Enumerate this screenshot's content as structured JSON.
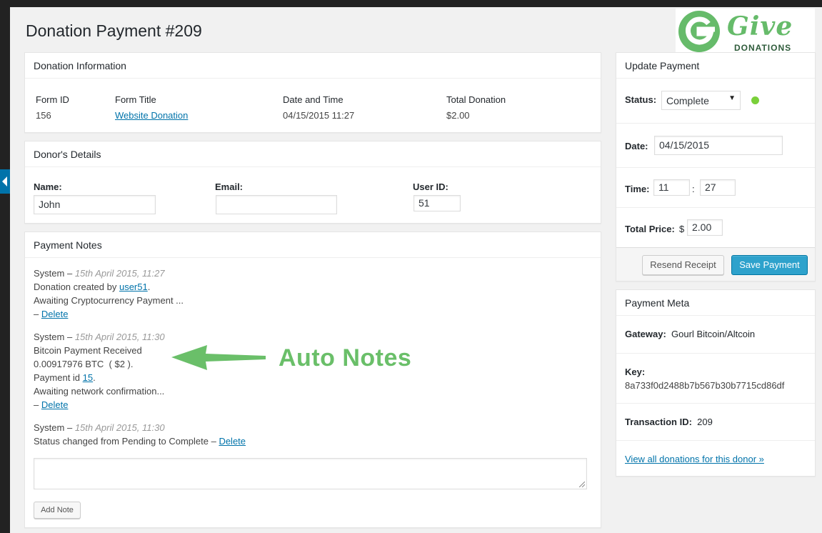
{
  "page": {
    "title": "Donation Payment #209"
  },
  "logo": {
    "word": "Give",
    "sub": "DONATIONS",
    "brand_color": "#66bb6a"
  },
  "donation_info": {
    "heading": "Donation Information",
    "form_id_label": "Form ID",
    "form_id": "156",
    "form_title_label": "Form Title",
    "form_title": "Website Donation",
    "date_label": "Date and Time",
    "date": "04/15/2015 11:27",
    "total_label": "Total Donation",
    "total": "$2.00"
  },
  "donor": {
    "heading": "Donor's Details",
    "name_label": "Name:",
    "name_value": "John",
    "email_label": "Email:",
    "email_value": "",
    "userid_label": "User ID:",
    "userid_value": "51"
  },
  "notes": {
    "heading": "Payment Notes",
    "items": [
      {
        "who": "System",
        "sep": " – ",
        "when": "15th April 2015, 11:27",
        "line1_prefix": "Donation created by ",
        "line1_link": "user51",
        "line1_suffix": ".",
        "line2": "Awaiting Cryptocurrency Payment ...",
        "dash": " – ",
        "delete": "Delete"
      },
      {
        "who": "System",
        "sep": " – ",
        "when": "15th April 2015, 11:30",
        "line1": "Bitcoin Payment Received",
        "line2": "0.00917976 BTC  ( $2 ).",
        "line3_prefix": "Payment id ",
        "line3_link": "15",
        "line3_suffix": ".",
        "line4": "Awaiting network confirmation...",
        "dash": " – ",
        "delete": "Delete"
      },
      {
        "who": "System",
        "sep": " – ",
        "when": "15th April 2015, 11:30",
        "line1": "Status changed from Pending to Complete – ",
        "delete": "Delete"
      }
    ],
    "add_note_label": "Add Note"
  },
  "annotation": {
    "text": "Auto Notes",
    "color": "#6abf69"
  },
  "update": {
    "heading": "Update Payment",
    "status_label": "Status:",
    "status_value": "Complete",
    "status_color": "#7ad03a",
    "date_label": "Date:",
    "date_value": "04/15/2015",
    "time_label": "Time:",
    "hour": "11",
    "colon": ":",
    "minute": "27",
    "price_label": "Total Price:",
    "currency": "$",
    "price_value": "2.00",
    "resend_label": "Resend Receipt",
    "save_label": "Save Payment"
  },
  "meta": {
    "heading": "Payment Meta",
    "gateway_label": "Gateway:",
    "gateway_value": "Gourl Bitcoin/Altcoin",
    "key_label": "Key:",
    "key_value": "8a733f0d2488b7b567b30b7715cd86df",
    "txn_label": "Transaction ID:",
    "txn_value": "209",
    "view_all": "View all donations for this donor »"
  }
}
